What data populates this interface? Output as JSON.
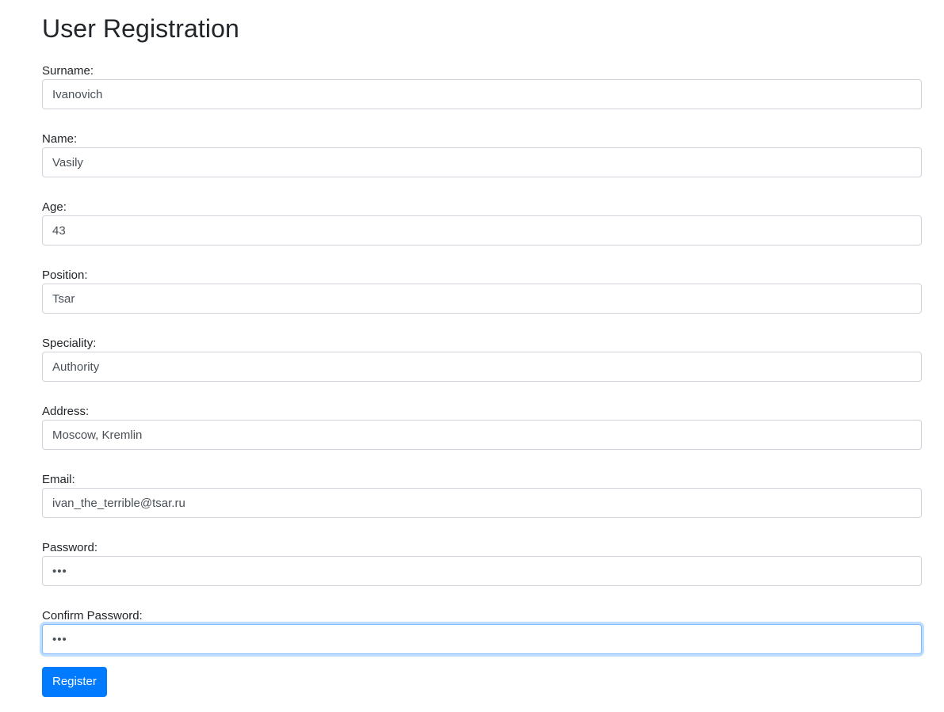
{
  "page": {
    "title": "User Registration"
  },
  "form": {
    "fields": [
      {
        "id": "surname",
        "label": "Surname:",
        "value": "Ivanovich",
        "type": "text"
      },
      {
        "id": "name",
        "label": "Name:",
        "value": "Vasily",
        "type": "text"
      },
      {
        "id": "age",
        "label": "Age:",
        "value": "43",
        "type": "text"
      },
      {
        "id": "position",
        "label": "Position:",
        "value": "Tsar",
        "type": "text"
      },
      {
        "id": "speciality",
        "label": "Speciality:",
        "value": "Authority",
        "type": "text"
      },
      {
        "id": "address",
        "label": "Address:",
        "value": "Moscow, Kremlin",
        "type": "text"
      },
      {
        "id": "email",
        "label": "Email:",
        "value": "ivan_the_terrible@tsar.ru",
        "type": "text"
      },
      {
        "id": "password",
        "label": "Password:",
        "value": "•••",
        "type": "password"
      },
      {
        "id": "confirm-password",
        "label": "Confirm Password:",
        "value": "•••",
        "type": "password",
        "focused": true
      }
    ],
    "submit_label": "Register"
  },
  "colors": {
    "primary": "#007bff",
    "text": "#212529",
    "input_text": "#495057",
    "input_border": "#ced4da",
    "focus_border": "#80bdff"
  }
}
